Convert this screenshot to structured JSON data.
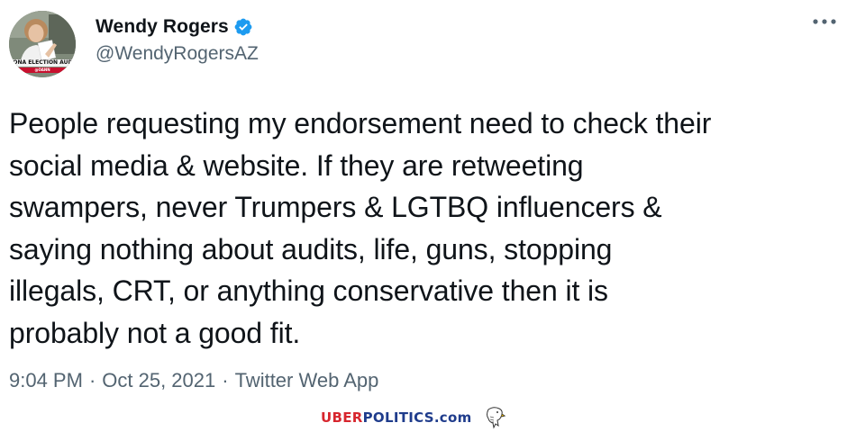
{
  "author": {
    "display_name": "Wendy Rogers",
    "handle": "@WendyRogersAZ",
    "verified": true,
    "avatar_caption": "ZONA ELECTION AUDIT REV",
    "avatar_subcaption": "@OANN"
  },
  "tweet": {
    "text": "People requesting my endorsement need to check their\nsocial media & website. If they are retweeting\nswampers, never Trumpers & LGTBQ influencers &\nsaying nothing about audits, life, guns, stopping\nillegals, CRT, or anything conservative then it is\nprobably not a good fit."
  },
  "meta": {
    "time": "9:04 PM",
    "date": "Oct 25, 2021",
    "separator": "·",
    "source": "Twitter Web App"
  },
  "menu": {
    "icon": "more-horizontal-icon"
  },
  "watermark": {
    "part1": "UBER",
    "part2": "POLITICS",
    "part3": ".com",
    "icon": "eagle-icon"
  },
  "colors": {
    "text_primary": "#0f1419",
    "text_secondary": "#536471",
    "verified_blue": "#1d9bf0",
    "watermark_red": "#d7262e",
    "watermark_blue": "#1f3c8c"
  }
}
